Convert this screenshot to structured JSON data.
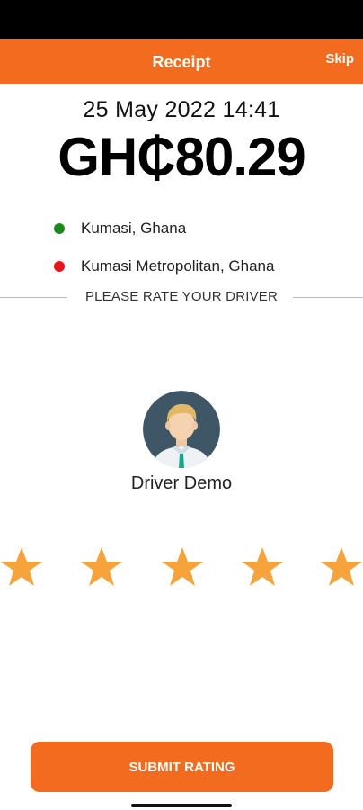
{
  "header": {
    "title": "Receipt",
    "skip_label": "Skip"
  },
  "receipt": {
    "date": "25 May 2022 14:41",
    "amount": "GH₵80.29"
  },
  "locations": {
    "pickup": {
      "label": "Kumasi, Ghana",
      "dot_color": "#1a8a1a"
    },
    "dropoff": {
      "label": "Kumasi Metropolitan, Ghana",
      "dot_color": "#e8141a"
    }
  },
  "rating": {
    "prompt": "PLEASE RATE YOUR DRIVER",
    "driver_name": "Driver Demo",
    "star_count": 5,
    "star_color": "#f6a33c"
  },
  "actions": {
    "submit_label": "SUBMIT RATING"
  },
  "colors": {
    "accent": "#f26b1f"
  },
  "icons": {
    "avatar": "driver-avatar-icon",
    "star": "star-icon"
  }
}
